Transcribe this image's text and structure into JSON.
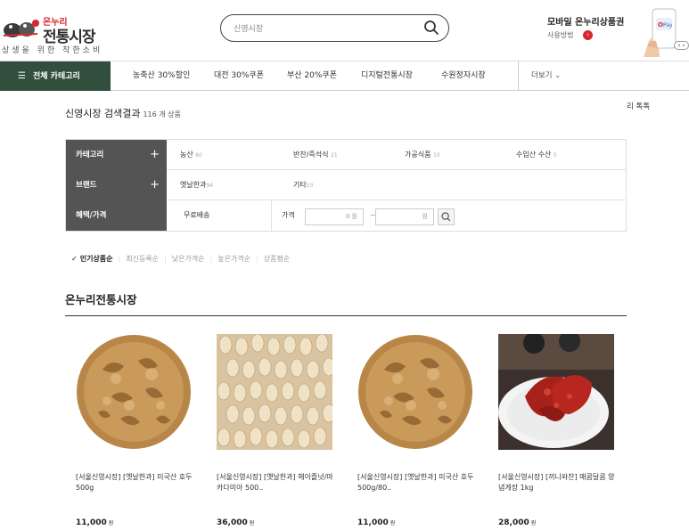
{
  "header": {
    "logo": {
      "brand_top": "온누리",
      "brand_main": "전통시장",
      "slogan": "상생을 위한 착한소비"
    },
    "search": {
      "value": "신영시장"
    },
    "promo": {
      "title": "모바일 온누리상품권",
      "link": "사용방법"
    }
  },
  "nav": {
    "all_categories": "전체 카테고리",
    "items": [
      "농축산 30%할인",
      "대전 30%쿠폰",
      "부산 20%쿠폰",
      "디지털전통시장",
      "수원정자시장"
    ],
    "more": "더보기"
  },
  "side_tab": "리 톡톡",
  "results": {
    "title": "신영시장 검색결과",
    "count": "116 개 상품"
  },
  "filter": {
    "category": {
      "label": "카테고리",
      "options": [
        {
          "name": "농산",
          "count": "80"
        },
        {
          "name": "반찬/즉석식",
          "count": "21"
        },
        {
          "name": "가공식품",
          "count": "10"
        },
        {
          "name": "수입산 수산",
          "count": "5"
        }
      ]
    },
    "brand": {
      "label": "브랜드",
      "options": [
        {
          "name": "옛날한과",
          "count": "94"
        },
        {
          "name": "기타",
          "count": "23"
        }
      ]
    },
    "benefit": {
      "label": "혜택/가격",
      "free_shipping": "무료배송",
      "price_label": "가격",
      "min_suffix": "0 원",
      "max_suffix": "원",
      "tilde": "~"
    }
  },
  "sort": {
    "items": [
      "인기상품순",
      "최신등록순",
      "낮은가격순",
      "높은가격순",
      "상품평순"
    ],
    "active_index": 0
  },
  "section": {
    "title": "온누리전통시장"
  },
  "products": [
    {
      "name": "[서울신영시장] [옛날한과] 미국산 호두 500g",
      "price": "11,000",
      "currency": "원"
    },
    {
      "name": "[서울신영시장] [옛날한과] 헤이즐넛/마카다미아 500..",
      "price": "36,000",
      "currency": "원"
    },
    {
      "name": "[서울신영시장] [옛날한과] 미국산 호두 500g/80..",
      "price": "11,000",
      "currency": "원"
    },
    {
      "name": "[서울신영시장] [끼니와찬] 매콤달콤 양념게장 1kg",
      "price": "28,000",
      "currency": "원"
    }
  ],
  "colors": {
    "nav_dark": "#324e3d",
    "filter_label": "#545454",
    "accent_red": "#d6282f"
  }
}
